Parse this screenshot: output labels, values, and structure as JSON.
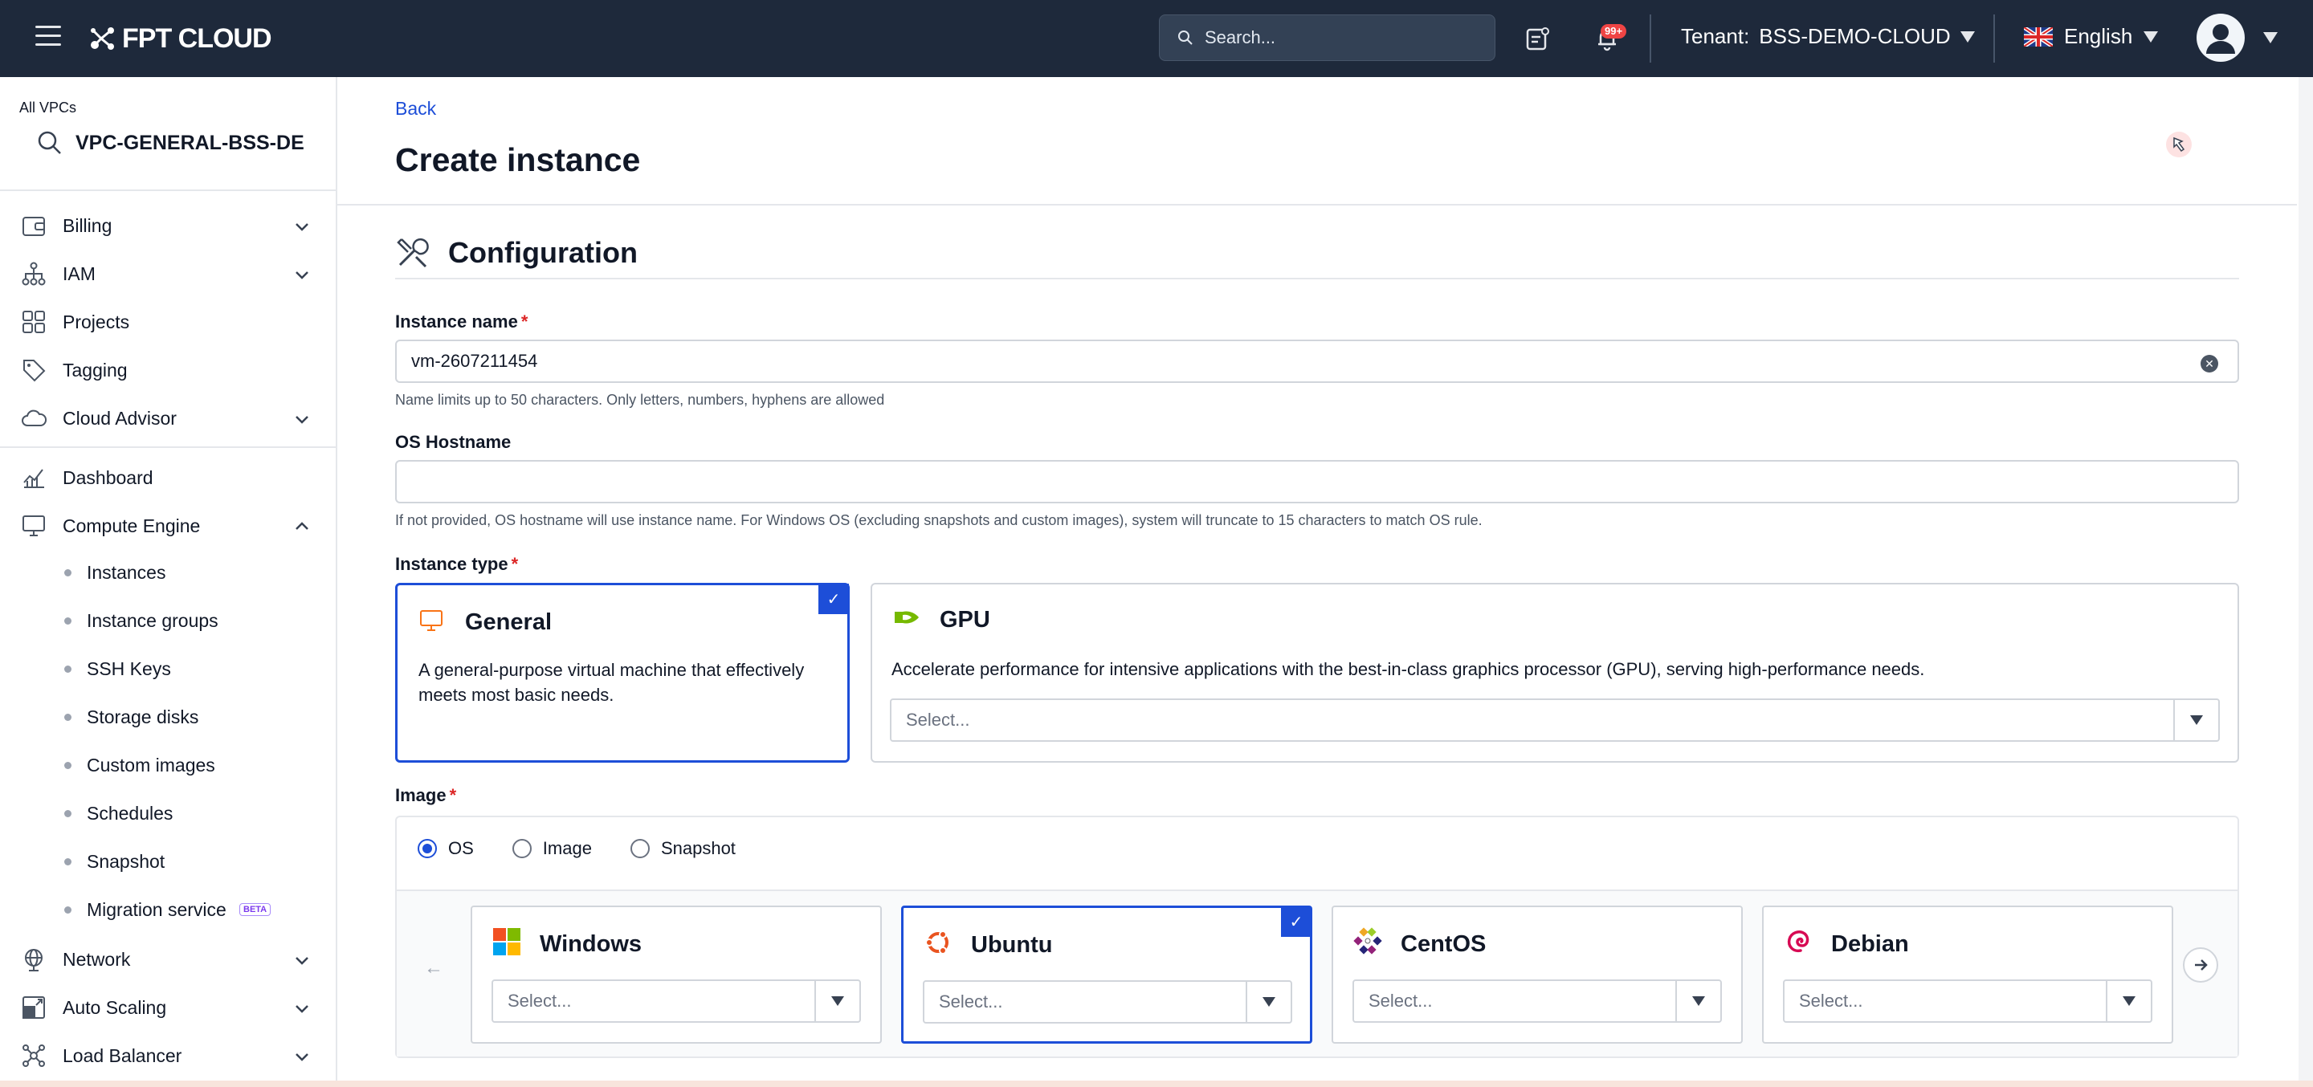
{
  "topbar": {
    "brand": "FPT CLOUD",
    "search_placeholder": "Search...",
    "notification_badge": "99+",
    "tenant_label": "Tenant:",
    "tenant_value": "BSS-DEMO-CLOUD",
    "language": "English"
  },
  "sidebar": {
    "vpc_label": "All VPCs",
    "vpc_name": "VPC-GENERAL-BSS-DE",
    "items": [
      {
        "label": "Billing",
        "icon": "wallet-icon"
      },
      {
        "label": "IAM",
        "icon": "hierarchy-icon"
      },
      {
        "label": "Projects",
        "icon": "grid-icon"
      },
      {
        "label": "Tagging",
        "icon": "tag-icon"
      },
      {
        "label": "Cloud Advisor",
        "icon": "cloud-icon"
      },
      {
        "label": "Dashboard",
        "icon": "chart-icon"
      },
      {
        "label": "Compute Engine",
        "icon": "monitor-icon"
      },
      {
        "label": "Network",
        "icon": "globe-icon"
      },
      {
        "label": "Auto Scaling",
        "icon": "scaling-icon"
      },
      {
        "label": "Load Balancer",
        "icon": "network-icon"
      }
    ],
    "compute_sub": [
      {
        "label": "Instances"
      },
      {
        "label": "Instance groups"
      },
      {
        "label": "SSH Keys"
      },
      {
        "label": "Storage disks"
      },
      {
        "label": "Custom images"
      },
      {
        "label": "Schedules"
      },
      {
        "label": "Snapshot"
      },
      {
        "label": "Migration service",
        "badge": "BETA"
      }
    ]
  },
  "main": {
    "back": "Back",
    "title": "Create instance",
    "section_title": "Configuration",
    "instance_name": {
      "label": "Instance name",
      "value": "vm-2607211454",
      "hint": "Name limits up to 50 characters. Only letters, numbers, hyphens are allowed"
    },
    "os_hostname": {
      "label": "OS Hostname",
      "value": "",
      "hint": "If not provided, OS hostname will use instance name. For Windows OS (excluding snapshots and custom images), system will truncate to 15 characters to match OS rule."
    },
    "instance_type": {
      "label": "Instance type",
      "general": {
        "title": "General",
        "desc": "A general-purpose virtual machine that effectively meets most basic needs.",
        "selected": true
      },
      "gpu": {
        "title": "GPU",
        "desc": "Accelerate performance for intensive applications with the best-in-class graphics processor (GPU), serving high-performance needs.",
        "select_placeholder": "Select..."
      }
    },
    "image": {
      "label": "Image",
      "radios": [
        {
          "label": "OS",
          "checked": true
        },
        {
          "label": "Image",
          "checked": false
        },
        {
          "label": "Snapshot",
          "checked": false
        }
      ],
      "os_cards": [
        {
          "name": "Windows",
          "placeholder": "Select...",
          "selected": false
        },
        {
          "name": "Ubuntu",
          "placeholder": "Select...",
          "selected": true
        },
        {
          "name": "CentOS",
          "placeholder": "Select...",
          "selected": false
        },
        {
          "name": "Debian",
          "placeholder": "Select...",
          "selected": false
        }
      ]
    }
  },
  "colors": {
    "topbar_bg": "#1e293b",
    "accent": "#1d4ed8",
    "required": "#dc2626"
  }
}
